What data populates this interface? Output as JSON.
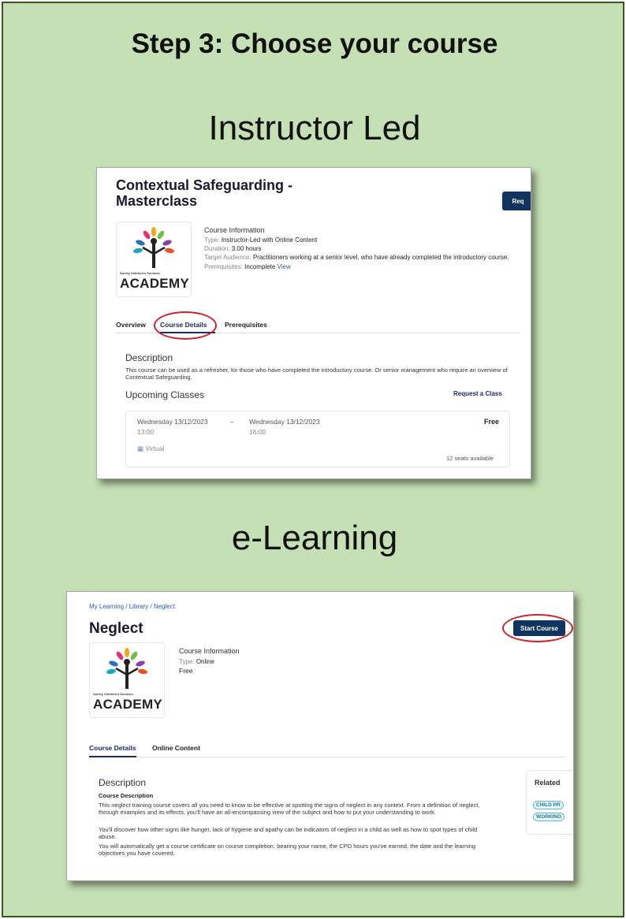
{
  "page": {
    "step_heading": "Step 3: Choose your course",
    "instructor_heading": "Instructor Led",
    "elearning_heading": "e-Learning"
  },
  "logo": {
    "tagline": "Surrey Children's Services",
    "name": "ACADEMY"
  },
  "instructor": {
    "title_line1": "Contextual Safeguarding -",
    "title_line2": "Masterclass",
    "request_button": "Req",
    "info_heading": "Course Information",
    "type_label": "Type:",
    "type_value": "Instructor-Led with Online Content",
    "duration_label": "Duration:",
    "duration_value": "3.00 hours",
    "audience_label": "Target Audience:",
    "audience_value": "Practitioners working at a senior level, who have already completed the introductory course.",
    "prereq_label": "Prerequisites:",
    "prereq_value": "Incomplete",
    "prereq_link": "View",
    "tabs": [
      "Overview",
      "Course Details",
      "Prerequisites"
    ],
    "description_title": "Description",
    "description_text": "This course can be used as a refresher, for those who have completed the introductory course. Or senior management who require an overview of Contextual Safeguarding.",
    "upcoming_title": "Upcoming Classes",
    "request_class_link": "Request a Class",
    "class": {
      "start_date": "Wednesday 13/12/2023",
      "start_time": "13:00",
      "separator": "–",
      "end_date": "Wednesday 13/12/2023",
      "end_time": "16:00",
      "price": "Free",
      "location": "Virtual",
      "seats": "12 seats available"
    }
  },
  "elearning": {
    "breadcrumb": "My Learning / Library / Neglect",
    "title": "Neglect",
    "start_button": "Start Course",
    "info_heading": "Course Information",
    "type_label": "Type:",
    "type_value": "Online",
    "price": "Free",
    "tabs": [
      "Course Details",
      "Online Content"
    ],
    "description_title": "Description",
    "course_desc_heading": "Course Description",
    "paragraphs": [
      "This neglect training course covers all you need to know to be effective at spotting the signs of neglect in any context. From a definition of neglect, through examples and its effects, you'll have an all-encompassing view of the subject and how to put your understanding to work.",
      "You'll discover how other signs like hunger, lack of hygiene and apathy can be indicators of neglect in a child as well as how to spot types of child abuse.",
      "You will automatically get a course certificate on course completion, bearing your name, the CPD hours you've earned, the date and the learning objectives you have covered."
    ],
    "related_title": "Related ",
    "related_tags": [
      "CHILD PR",
      "WORKING"
    ]
  },
  "colors": {
    "background": "#c5e0b4",
    "border": "#385723",
    "button": "#0f3460",
    "highlight_circle": "#d0202a"
  }
}
